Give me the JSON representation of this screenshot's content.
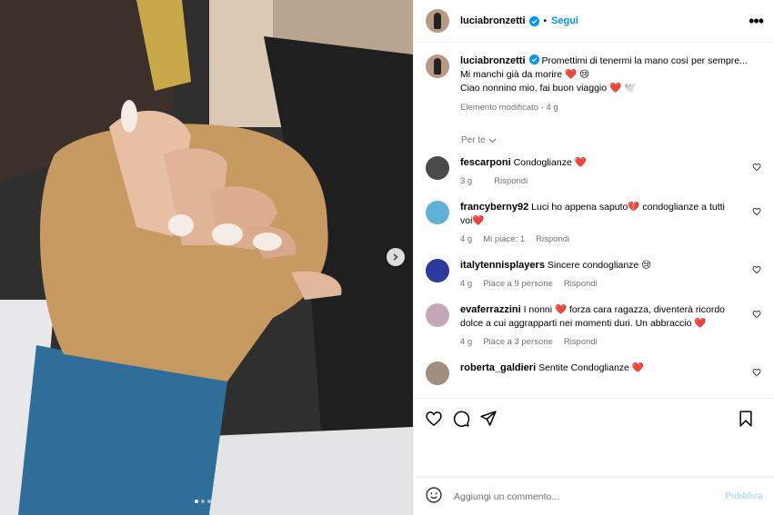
{
  "post": {
    "author": "luciabronzetti",
    "follow_label": "Segui",
    "separator": "•",
    "more_label": "•••"
  },
  "caption": {
    "username": "luciabronzetti",
    "line1": "Promettimi di tenermi la mano così per sempre...",
    "line2": "Mi manchi già da morire ❤️ 😢",
    "line3": "Ciao nonnino mio, fai buon viaggio ❤️ 🕊️",
    "edited": "Elemento modificato · 4 g"
  },
  "for_you_label": "Per te",
  "comments": [
    {
      "username": "fescarponi",
      "text": "Condoglianze ❤️",
      "time": "3 g",
      "likes": "",
      "reply": "Rispondi",
      "avatar_color": "#4a4a4a"
    },
    {
      "username": "francyberny92",
      "text": "Luci ho appena saputo💔 condoglianze a tutti voi❤️",
      "time": "4 g",
      "likes": "Mi piace: 1",
      "reply": "Rispondi",
      "avatar_color": "#5fb2d6"
    },
    {
      "username": "italytennisplayers",
      "text": "Sincere condoglianze 😢",
      "time": "4 g",
      "likes": "Piace a 9 persone",
      "reply": "Rispondi",
      "avatar_color": "#2b3a9c"
    },
    {
      "username": "evaferrazzini",
      "text": "I nonni ❤️ forza cara ragazza, diventerà ricordo dolce a cui aggrapparti nei momenti duri. Un abbraccio ❤️",
      "time": "4 g",
      "likes": "Piace a 3 persone",
      "reply": "Rispondi",
      "avatar_color": "#c4a7b6"
    },
    {
      "username": "roberta_galdieri",
      "text": "Sentite Condoglianze ❤️",
      "time": "",
      "likes": "",
      "reply": "",
      "avatar_color": "#a08f7c"
    }
  ],
  "add_comment": {
    "placeholder": "Aggiungi un commento...",
    "publish_label": "Pubblica"
  },
  "icons": {
    "like": "heart-icon",
    "comment": "comment-icon",
    "share": "send-icon",
    "save": "bookmark-icon",
    "emoji": "emoji-icon",
    "next": "chevron-right-icon"
  },
  "colors": {
    "link": "#0095f6",
    "muted": "#737373",
    "publish_disabled": "#b2dffc",
    "verified": "#0095f6"
  },
  "carousel": {
    "current": 1,
    "total": 3
  }
}
